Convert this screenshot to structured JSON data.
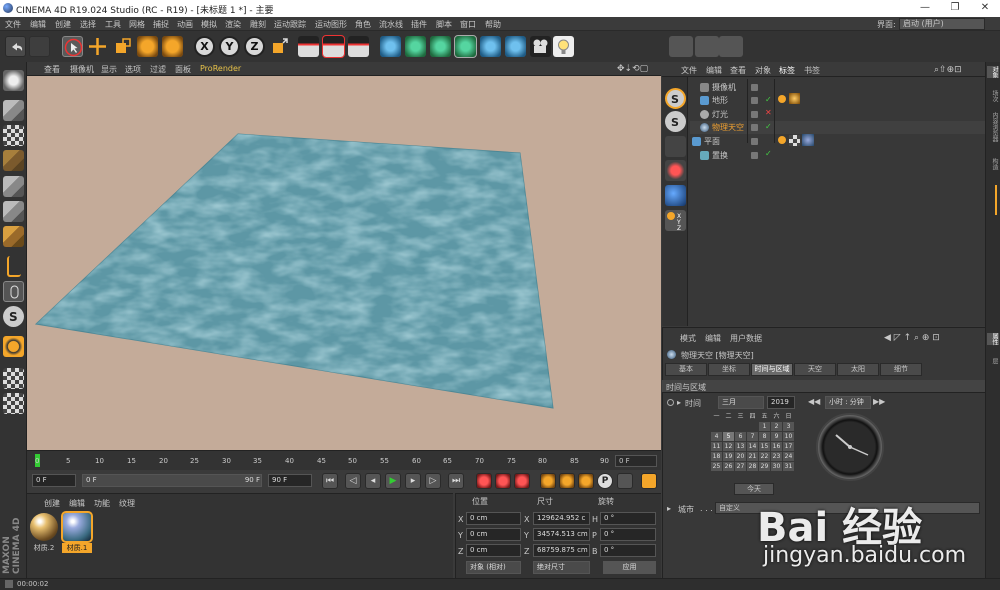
{
  "window": {
    "title": "CINEMA 4D R19.024 Studio (RC - R19) - [未标题 1 *] - 主要"
  },
  "menu": [
    "文件",
    "编辑",
    "创建",
    "选择",
    "工具",
    "网格",
    "捕捉",
    "动画",
    "模拟",
    "渲染",
    "雕刻",
    "运动跟踪",
    "运动图形",
    "角色",
    "流水线",
    "插件",
    "脚本",
    "窗口",
    "帮助"
  ],
  "layout": {
    "label": "界面:",
    "value": "启动 (用户)"
  },
  "viewport_menu": [
    "查看",
    "摄像机",
    "显示",
    "选项",
    "过滤",
    "面板",
    "ProRender"
  ],
  "timeline": {
    "ticks": [
      "0",
      "5",
      "10",
      "15",
      "20",
      "25",
      "30",
      "35",
      "40",
      "45",
      "50",
      "55",
      "60",
      "65",
      "70",
      "75",
      "80",
      "85",
      "90"
    ],
    "end_field": "0 F"
  },
  "transport": {
    "start": "0 F",
    "current": "0 F",
    "range_end": "90 F",
    "end": "90 F"
  },
  "material_panel": {
    "tabs": [
      "创建",
      "编辑",
      "功能",
      "纹理"
    ],
    "materials": [
      {
        "label": "材质.2"
      },
      {
        "label": "材质.1"
      }
    ]
  },
  "coords": {
    "headers": {
      "position": "位置",
      "size": "尺寸",
      "rotation": "旋转"
    },
    "rows": [
      {
        "axis": "X",
        "pos": "0 cm",
        "size_axis": "X",
        "size": "129624.952 c",
        "rot_axis": "H",
        "rot": "0 °"
      },
      {
        "axis": "Y",
        "pos": "0 cm",
        "size_axis": "Y",
        "size": "34574.513 cm",
        "rot_axis": "P",
        "rot": "0 °"
      },
      {
        "axis": "Z",
        "pos": "0 cm",
        "size_axis": "Z",
        "size": "68759.875 cm",
        "rot_axis": "B",
        "rot": "0 °"
      }
    ],
    "mode_object": "对象 (相对)",
    "mode_size": "绝对尺寸",
    "apply": "应用"
  },
  "object_manager": {
    "menu": [
      "文件",
      "编辑",
      "查看",
      "对象",
      "标签",
      "书签"
    ],
    "objects": [
      {
        "name": "摄像机",
        "color": "#cccccc",
        "highlight": false
      },
      {
        "name": "地形",
        "color": "#cccccc",
        "highlight": false
      },
      {
        "name": "灯光",
        "color": "#cccccc",
        "highlight": false
      },
      {
        "name": "物理天空",
        "color": "#f0a030",
        "highlight": true
      },
      {
        "name": "平面",
        "color": "#cccccc",
        "highlight": false
      },
      {
        "name": "置换",
        "color": "#cccccc",
        "highlight": false
      }
    ]
  },
  "attribute_manager": {
    "menu": [
      "模式",
      "编辑",
      "用户数据"
    ],
    "title": "物理天空 [物理天空]",
    "tabs": [
      "基本",
      "坐标",
      "时间与区域",
      "天空",
      "太阳",
      "细节"
    ],
    "active_tab": "时间与区域",
    "section": "时间与区域",
    "time_label": "时间",
    "month": "三月",
    "year": "2019",
    "time_format": "小时 : 分钟",
    "weekdays": [
      "一",
      "二",
      "三",
      "四",
      "五",
      "六",
      "日"
    ],
    "days": [
      "",
      "",
      "",
      "",
      "1",
      "2",
      "3",
      "4",
      "5",
      "6",
      "7",
      "8",
      "9",
      "10",
      "11",
      "12",
      "13",
      "14",
      "15",
      "16",
      "17",
      "18",
      "19",
      "20",
      "21",
      "22",
      "23",
      "24",
      "25",
      "26",
      "27",
      "28",
      "29",
      "30",
      "31"
    ],
    "selected_day": "5",
    "today": "今天",
    "city_label": "城市",
    "city_value": "自定义"
  },
  "right_tabs": [
    "对象",
    "场次",
    "内容浏览器",
    "构造",
    "属性",
    "层"
  ],
  "status": {
    "time": "00:00:02"
  },
  "watermark": {
    "brand": "Bai 经验",
    "url": "jingyan.baidu.com"
  }
}
